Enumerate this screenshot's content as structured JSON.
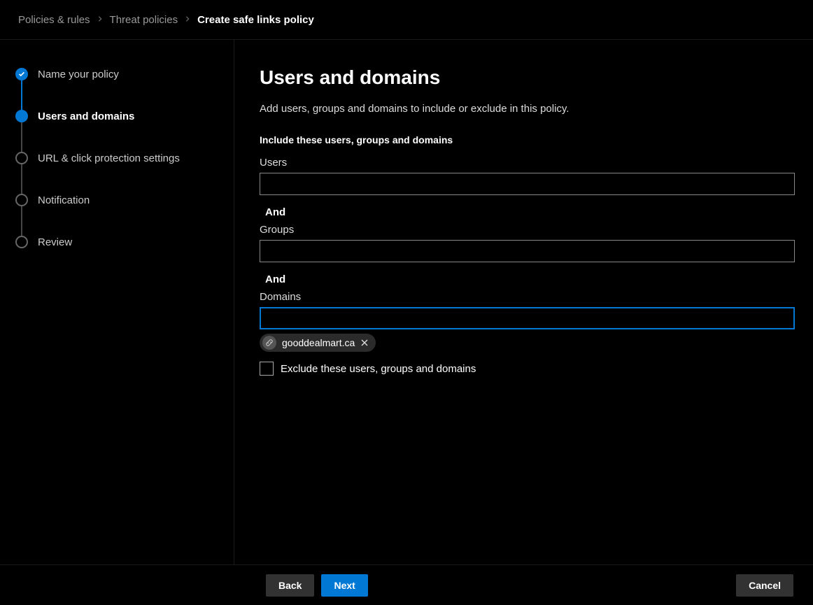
{
  "breadcrumb": {
    "items": [
      "Policies & rules",
      "Threat policies"
    ],
    "current": "Create safe links policy"
  },
  "steps": [
    {
      "label": "Name your policy",
      "state": "completed"
    },
    {
      "label": "Users and domains",
      "state": "current"
    },
    {
      "label": "URL & click protection settings",
      "state": "upcoming"
    },
    {
      "label": "Notification",
      "state": "upcoming"
    },
    {
      "label": "Review",
      "state": "upcoming"
    }
  ],
  "main": {
    "title": "Users and domains",
    "description": "Add users, groups and domains to include or exclude in this policy.",
    "include_heading": "Include these users, groups and domains",
    "and_label": "And",
    "fields": {
      "users": {
        "label": "Users",
        "value": ""
      },
      "groups": {
        "label": "Groups",
        "value": ""
      },
      "domains": {
        "label": "Domains",
        "value": "",
        "chips": [
          "gooddealmart.ca"
        ]
      }
    },
    "exclude_checkbox": {
      "label": "Exclude these users, groups and domains",
      "checked": false
    }
  },
  "footer": {
    "back": "Back",
    "next": "Next",
    "cancel": "Cancel"
  }
}
